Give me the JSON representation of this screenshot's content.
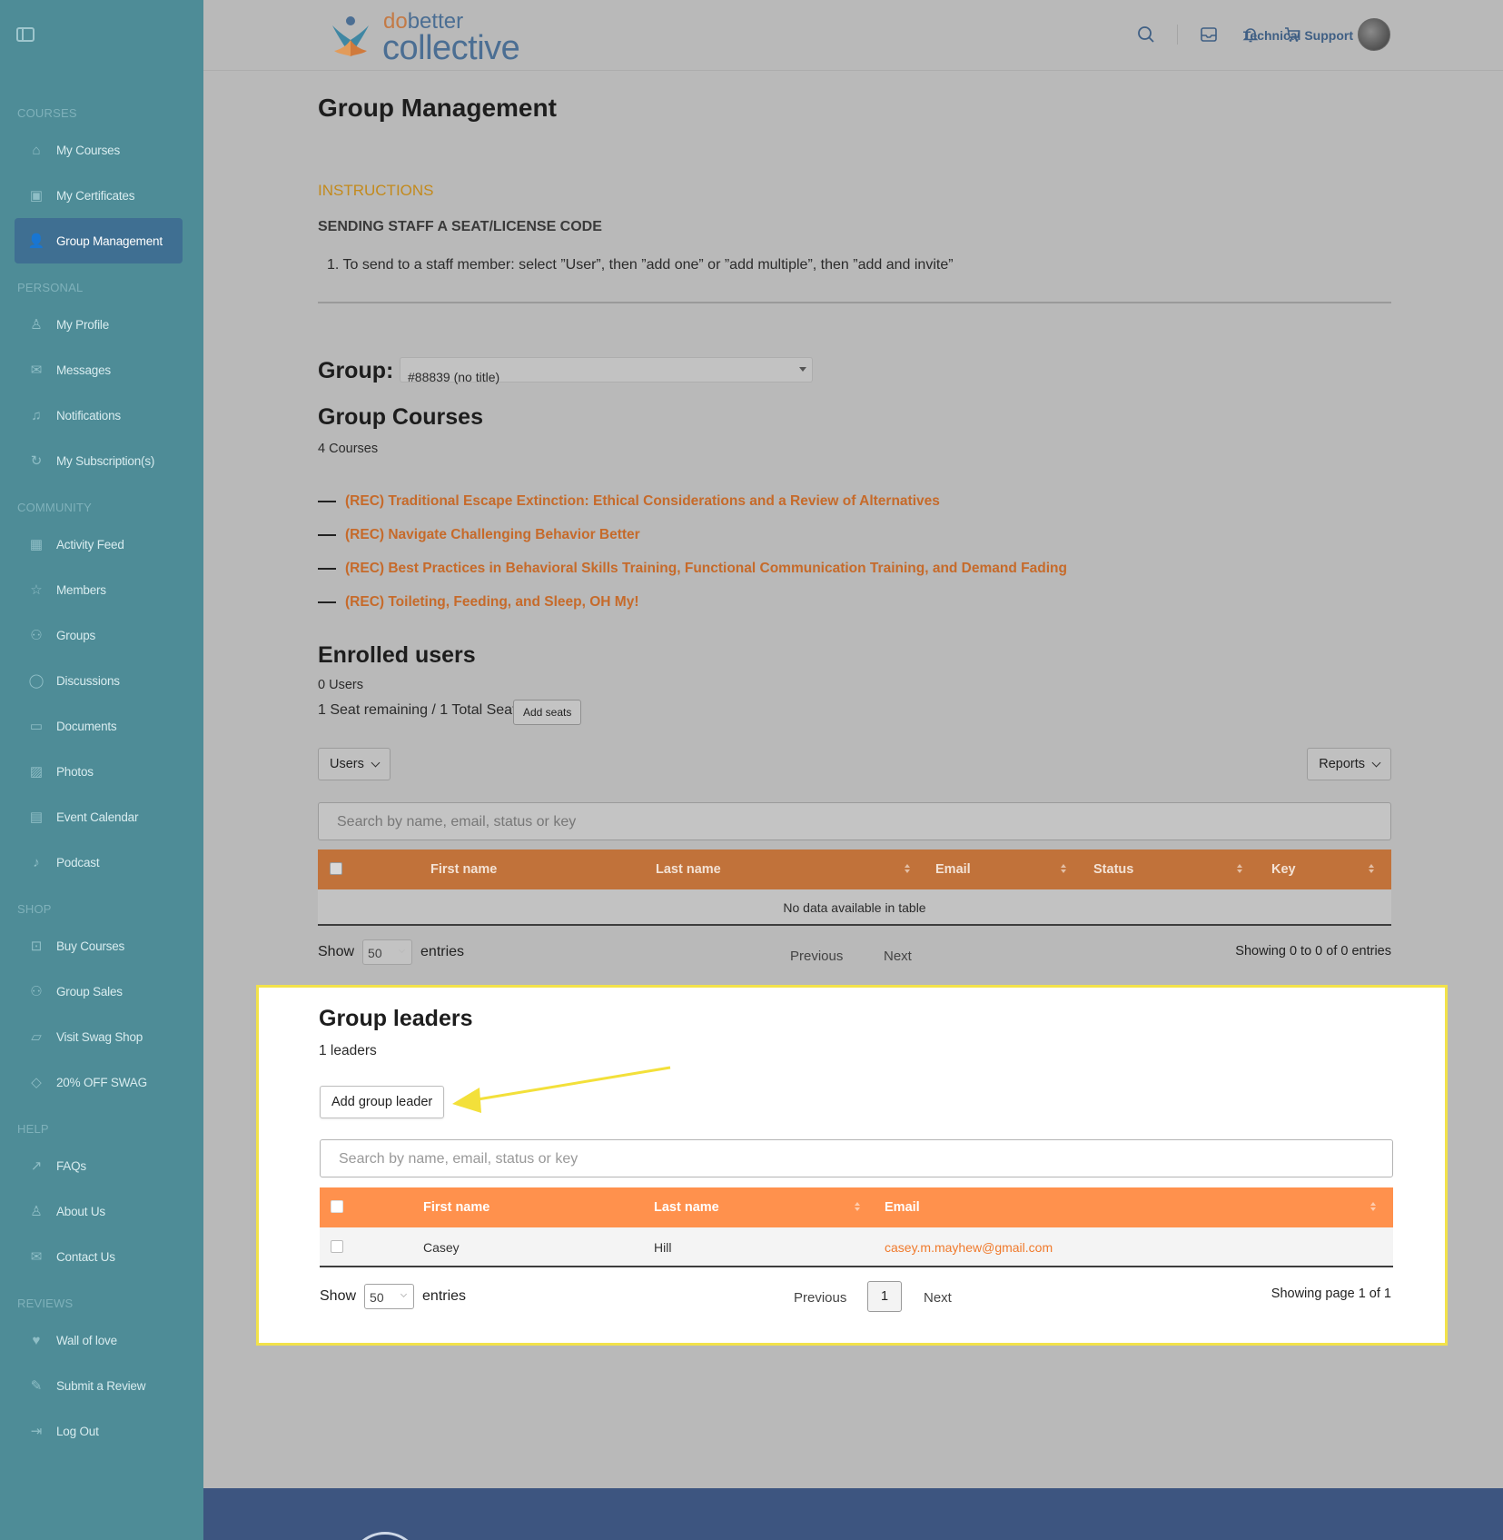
{
  "sidebar": {
    "sections": [
      {
        "label": "COURSES",
        "items": [
          {
            "label": "My Courses",
            "icon": "graduation-cap-icon",
            "glyph": "⌂"
          },
          {
            "label": "My Certificates",
            "icon": "certificate-icon",
            "glyph": "▣"
          },
          {
            "label": "Group Management",
            "icon": "user-group-icon",
            "glyph": "👤",
            "active": true
          }
        ]
      },
      {
        "label": "PERSONAL",
        "items": [
          {
            "label": "My Profile",
            "icon": "user-icon",
            "glyph": "♙"
          },
          {
            "label": "Messages",
            "icon": "inbox-icon",
            "glyph": "✉"
          },
          {
            "label": "Notifications",
            "icon": "bell-icon",
            "glyph": "♫"
          },
          {
            "label": "My Subscription(s)",
            "icon": "refresh-icon",
            "glyph": "↻"
          }
        ]
      },
      {
        "label": "COMMUNITY",
        "items": [
          {
            "label": "Activity Feed",
            "icon": "activity-icon",
            "glyph": "▦"
          },
          {
            "label": "Members",
            "icon": "star-icon",
            "glyph": "☆"
          },
          {
            "label": "Groups",
            "icon": "groups-icon",
            "glyph": "⚇"
          },
          {
            "label": "Discussions",
            "icon": "chat-icon",
            "glyph": "◯"
          },
          {
            "label": "Documents",
            "icon": "folder-icon",
            "glyph": "▭"
          },
          {
            "label": "Photos",
            "icon": "image-icon",
            "glyph": "▨"
          },
          {
            "label": "Event Calendar",
            "icon": "calendar-icon",
            "glyph": "▤"
          },
          {
            "label": "Podcast",
            "icon": "microphone-icon",
            "glyph": "♪"
          }
        ]
      },
      {
        "label": "SHOP",
        "items": [
          {
            "label": "Buy Courses",
            "icon": "cart-icon",
            "glyph": "⊡"
          },
          {
            "label": "Group Sales",
            "icon": "groups-icon",
            "glyph": "⚇"
          },
          {
            "label": "Visit Swag Shop",
            "icon": "bag-icon",
            "glyph": "▱"
          },
          {
            "label": "20% OFF SWAG",
            "icon": "tag-icon",
            "glyph": "◇"
          }
        ]
      },
      {
        "label": "HELP",
        "items": [
          {
            "label": "FAQs",
            "icon": "external-link-icon",
            "glyph": "↗"
          },
          {
            "label": "About Us",
            "icon": "user-icon",
            "glyph": "♙"
          },
          {
            "label": "Contact Us",
            "icon": "mail-icon",
            "glyph": "✉"
          }
        ]
      },
      {
        "label": "REVIEWS",
        "items": [
          {
            "label": "Wall of love",
            "icon": "heart-icon",
            "glyph": "♥"
          },
          {
            "label": "Submit a Review",
            "icon": "pencil-icon",
            "glyph": "✎"
          },
          {
            "label": "Log Out",
            "icon": "logout-icon",
            "glyph": "⇥"
          }
        ]
      }
    ]
  },
  "header": {
    "logo_small_a": "do",
    "logo_small_b": "better",
    "logo_big": "collective",
    "user_name": "Technical Support"
  },
  "page": {
    "title": "Group Management",
    "instructions_heading": "INSTRUCTIONS",
    "instructions_sub": "SENDING STAFF A SEAT/LICENSE CODE",
    "instructions_step": "1. To send to a staff member: select ”User”, then ”add one” or ”add multiple”, then ”add and invite”",
    "group_label": "Group:",
    "group_value": "#88839 (no title)",
    "courses_title": "Group Courses",
    "courses_count": "4 Courses",
    "courses": [
      "(REC) Traditional Escape Extinction: Ethical Considerations and a Review of Alternatives",
      "(REC) Navigate Challenging Behavior Better",
      "(REC) Best Practices in Behavioral Skills Training, Functional Communication Training, and Demand Fading",
      "(REC) Toileting, Feeding, and Sleep, OH My!"
    ],
    "enrolled_title": "Enrolled users",
    "enrolled_count": "0 Users",
    "seats_text": "1 Seat remaining / 1 Total Seat",
    "add_seats_label": "Add seats",
    "users_dropdown": "Users",
    "reports_dropdown": "Reports",
    "search_placeholder": "Search by name, email, status or key",
    "users_table_headers": [
      "First name",
      "Last name",
      "Email",
      "Status",
      "Key"
    ],
    "no_data": "No data available in table",
    "show_label": "Show",
    "entries_label": "entries",
    "page_length": "50",
    "previous": "Previous",
    "next": "Next",
    "users_showing": "Showing 0 to 0 of 0 entries"
  },
  "leaders": {
    "title": "Group leaders",
    "count": "1 leaders",
    "add_button": "Add group leader",
    "search_placeholder": "Search by name, email, status or key",
    "headers": [
      "First name",
      "Last name",
      "Email"
    ],
    "rows": [
      {
        "first": "Casey",
        "last": "Hill",
        "email": "casey.m.mayhew@gmail.com"
      }
    ],
    "show_label": "Show",
    "entries_label": "entries",
    "page_length": "50",
    "previous": "Previous",
    "current_page": "1",
    "next": "Next",
    "showing": "Showing page 1 of 1"
  },
  "colors": {
    "sidebar": "#4e8c97",
    "accent_orange": "#ff914d",
    "highlight_border": "#f2e24a",
    "link_orange": "#c66a2a"
  }
}
